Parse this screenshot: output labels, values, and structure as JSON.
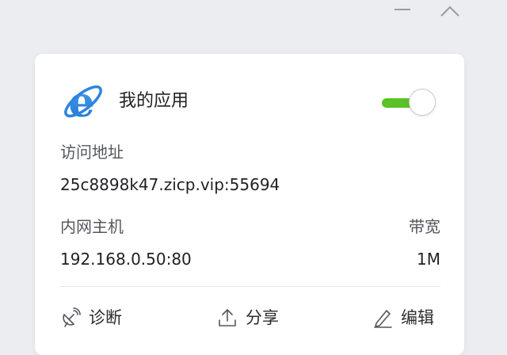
{
  "window": {
    "minimize_icon": "minimize-icon",
    "collapse_icon": "chevron-up-icon"
  },
  "app": {
    "icon": "ie-browser-icon",
    "name": "我的应用",
    "enabled": true,
    "toggle_color": "#5ac227"
  },
  "details": {
    "access_label": "访问地址",
    "access_value": "25c8898k47.zicp.vip:55694",
    "host_label": "内网主机",
    "host_value": "192.168.0.50:80",
    "bandwidth_label": "带宽",
    "bandwidth_value": "1M"
  },
  "actions": [
    {
      "label": "诊断",
      "icon": "satellite-dish-icon"
    },
    {
      "label": "分享",
      "icon": "share-upload-icon"
    },
    {
      "label": "编辑",
      "icon": "pencil-icon"
    }
  ]
}
